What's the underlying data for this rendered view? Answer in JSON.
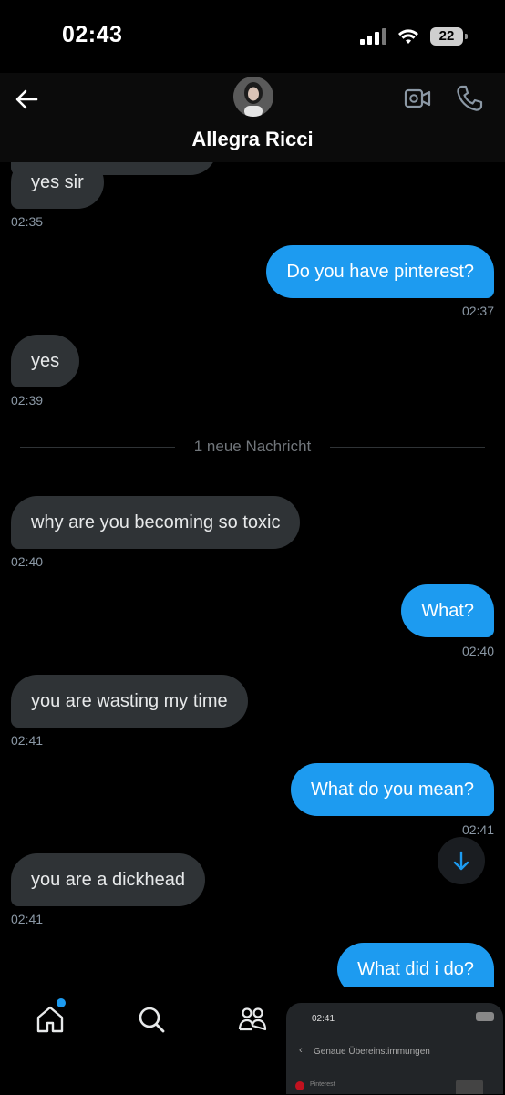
{
  "status_bar": {
    "time": "02:43",
    "battery": "22"
  },
  "header": {
    "name": "Allegra Ricci"
  },
  "messages": [
    {
      "text": "yes sir",
      "time": "02:35",
      "dir": "received"
    },
    {
      "text": "Do you have pinterest?",
      "time": "02:37",
      "dir": "sent"
    },
    {
      "text": "yes",
      "time": "02:39",
      "dir": "received"
    },
    {
      "text": "why are you becoming so toxic",
      "time": "02:40",
      "dir": "received"
    },
    {
      "text": "What?",
      "time": "02:40",
      "dir": "sent"
    },
    {
      "text": "you are wasting my time",
      "time": "02:41",
      "dir": "received"
    },
    {
      "text": "What do you mean?",
      "time": "02:41",
      "dir": "sent"
    },
    {
      "text": "you are a dickhead",
      "time": "02:41",
      "dir": "received"
    },
    {
      "text": "What did i do?",
      "time": "",
      "dir": "sent"
    }
  ],
  "divider": {
    "label": "1 neue Nachricht"
  },
  "nav": {
    "items": [
      "home-icon",
      "search-icon",
      "communities-icon",
      "notifications-icon",
      "messages-icon"
    ]
  },
  "overlay": {
    "time": "02:41",
    "title": "Genaue Übereinstimmungen",
    "subtitle": "Pinterest"
  },
  "colors": {
    "sent": "#1d9bf0",
    "received": "#2f3336",
    "background": "#000000"
  }
}
